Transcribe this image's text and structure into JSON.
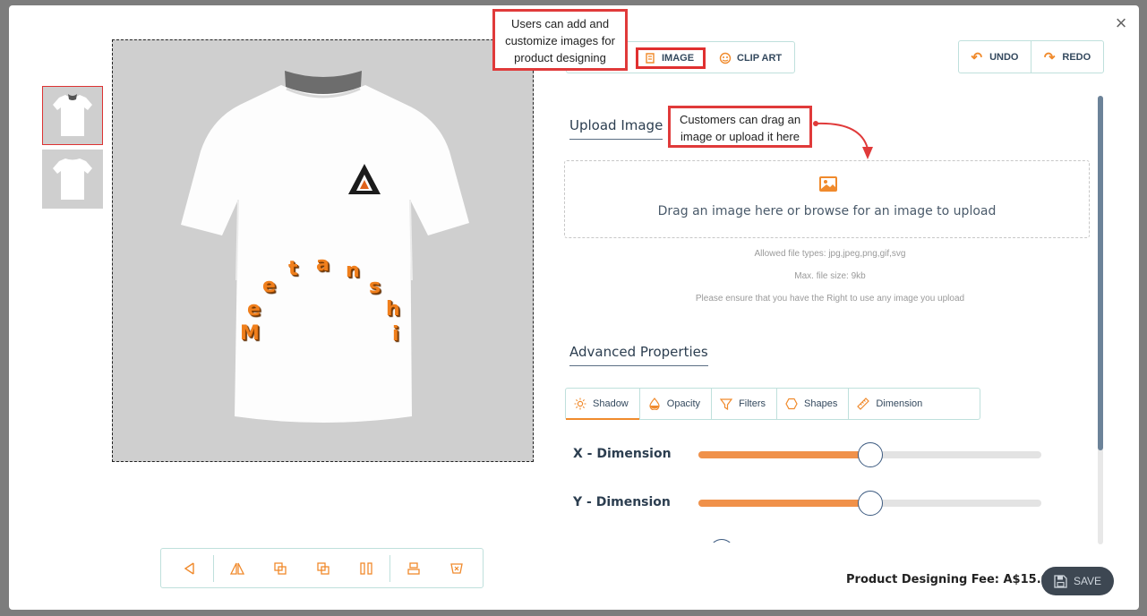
{
  "modal": {
    "close_glyph": "×"
  },
  "callouts": {
    "image_tab": "Users can add and customize images for product designing",
    "upload": "Customers can drag an image or upload it here"
  },
  "tabs": {
    "image": {
      "label": "IMAGE",
      "icon": "image-scroll-icon"
    },
    "clip_art": {
      "label": "CLIP ART",
      "icon": "clip-art-icon"
    }
  },
  "history": {
    "undo": "UNDO",
    "redo": "REDO"
  },
  "upload": {
    "title": "Upload Image",
    "dropzone_text": "Drag an image here or browse for an image to upload",
    "allowed_types": "Allowed file types: jpg,jpeg,png,gif,svg",
    "max_size": "Max. file size: 9kb",
    "rights_notice": "Please ensure that you have the Right to use any image you upload"
  },
  "advanced": {
    "title": "Advanced Properties",
    "tabs": [
      "Shadow",
      "Opacity",
      "Filters",
      "Shapes",
      "Dimension"
    ],
    "sliders": [
      {
        "label": "X - Dimension",
        "value_percent": 50
      },
      {
        "label": "Y - Dimension",
        "value_percent": 50
      }
    ]
  },
  "canvas": {
    "text_letters": [
      "M",
      "e",
      "e",
      "t",
      "a",
      "n",
      "s",
      "h",
      "i"
    ]
  },
  "footer": {
    "fee": "Product Designing Fee: A$15.00",
    "save": "SAVE"
  },
  "colors": {
    "accent": "#f08a2c",
    "callout_border": "#e03a3a",
    "navy": "#2c3e50"
  }
}
